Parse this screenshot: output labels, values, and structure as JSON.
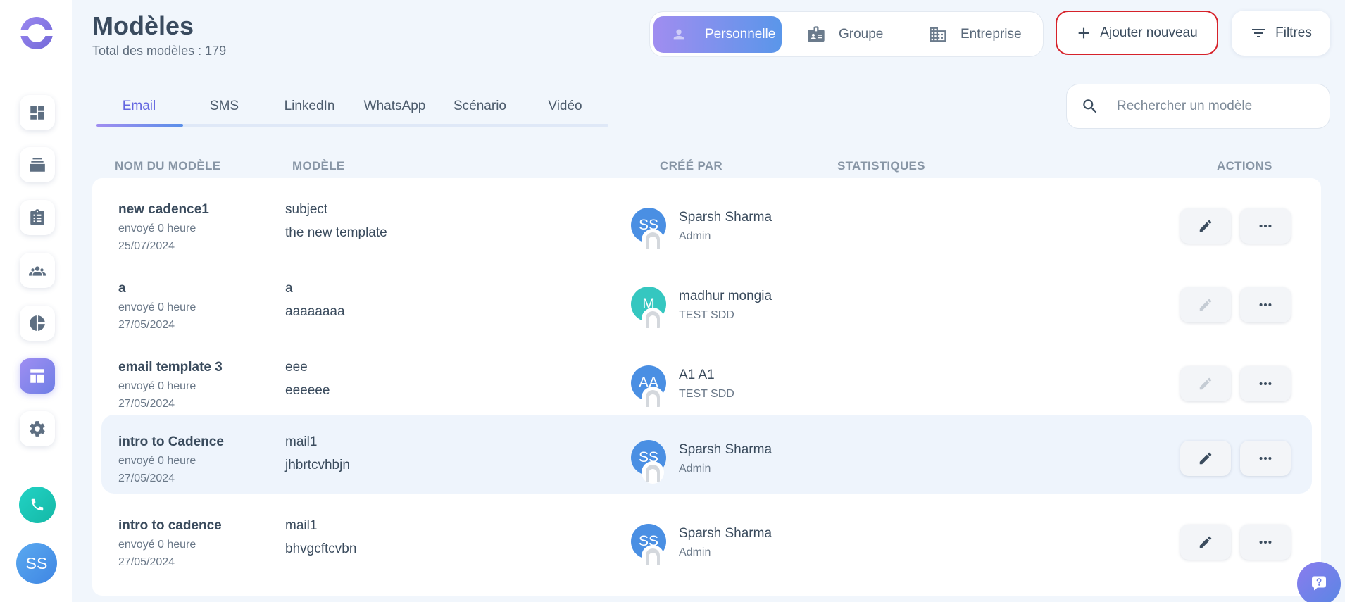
{
  "header": {
    "title": "Modèles",
    "subtitle": "Total des modèles : 179"
  },
  "scope": {
    "options": [
      {
        "label": "Personnelle",
        "icon": "person-icon",
        "active": true
      },
      {
        "label": "Groupe",
        "icon": "contact-card-icon",
        "active": false
      },
      {
        "label": "Entreprise",
        "icon": "building-icon",
        "active": false
      }
    ]
  },
  "toolbar": {
    "add_label": "Ajouter nouveau",
    "filter_label": "Filtres"
  },
  "tabs": [
    "Email",
    "SMS",
    "LinkedIn",
    "WhatsApp",
    "Scénario",
    "Vidéo"
  ],
  "active_tab": "Email",
  "search": {
    "placeholder": "Rechercher un modèle"
  },
  "table": {
    "columns": {
      "name": "NOM DU MODÈLE",
      "template": "MODÈLE",
      "created_by": "CRÉÉ PAR",
      "stats": "STATISTIQUES",
      "actions": "ACTIONS"
    },
    "rows": [
      {
        "name": "new cadence1",
        "sent": "envoyé 0 heure",
        "date": "25/07/2024",
        "subject": "subject",
        "body": "the new template",
        "initials": "SS",
        "creator": "Sparsh Sharma",
        "role": "Admin",
        "edit_enabled": true
      },
      {
        "name": "a",
        "sent": "envoyé 0 heure",
        "date": "27/05/2024",
        "subject": "a",
        "body": "aaaaaaaa",
        "initials": "M",
        "creator": "madhur mongia",
        "role": "TEST SDD",
        "edit_enabled": false
      },
      {
        "name": "email template 3",
        "sent": "envoyé 0 heure",
        "date": "27/05/2024",
        "subject": "eee",
        "body": "eeeeee",
        "initials": "AA",
        "creator": "A1 A1",
        "role": "TEST SDD",
        "edit_enabled": false
      },
      {
        "name": "intro to Cadence",
        "sent": "envoyé 0 heure",
        "date": "27/05/2024",
        "subject": "mail1",
        "body": "jhbrtcvhbjn",
        "initials": "SS",
        "creator": "Sparsh Sharma",
        "role": "Admin",
        "edit_enabled": true
      },
      {
        "name": "intro to cadence",
        "sent": "envoyé 0 heure",
        "date": "27/05/2024",
        "subject": "mail1",
        "body": "bhvgcftcvbn",
        "initials": "SS",
        "creator": "Sparsh Sharma",
        "role": "Admin",
        "edit_enabled": true
      }
    ]
  },
  "sidebar": {
    "items": [
      {
        "icon": "dashboard-icon",
        "active": false
      },
      {
        "icon": "cadence-stack-icon",
        "active": false
      },
      {
        "icon": "tasks-clipboard-icon",
        "active": false
      },
      {
        "icon": "people-icon",
        "active": false
      },
      {
        "icon": "pie-chart-icon",
        "active": false
      },
      {
        "icon": "templates-icon",
        "active": true
      },
      {
        "icon": "gear-icon",
        "active": false
      }
    ],
    "user_initials": "SS"
  },
  "colors": {
    "accent": "#6366e0",
    "highlight_border": "#d6222a",
    "avatar_blue": "#4a8fe3",
    "avatar_teal": "#35c7c0",
    "call_green": "#14b8a6"
  }
}
